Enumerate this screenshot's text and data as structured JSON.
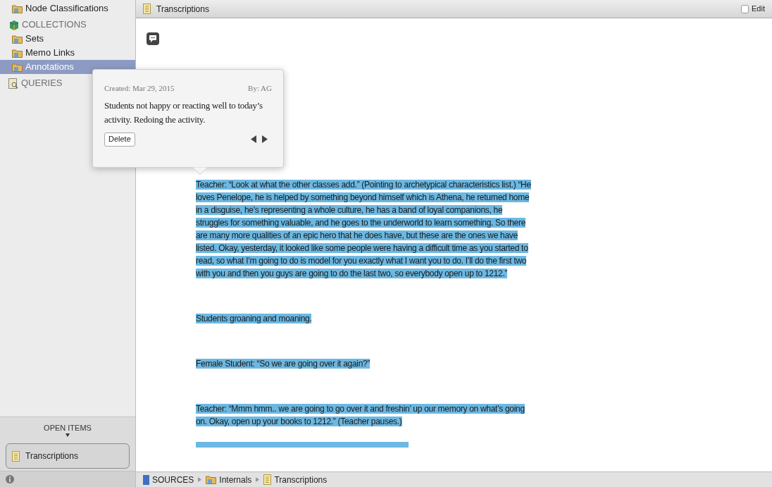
{
  "sidebar": {
    "items": [
      {
        "kind": "item",
        "label": "Node Classifications",
        "selected": false
      },
      {
        "kind": "section",
        "label": "COLLECTIONS",
        "children": [
          {
            "kind": "item",
            "label": "Sets",
            "selected": false
          },
          {
            "kind": "item",
            "label": "Memo Links",
            "selected": false
          },
          {
            "kind": "item",
            "label": "Annotations",
            "selected": true
          }
        ]
      },
      {
        "kind": "section",
        "label": "QUERIES"
      }
    ]
  },
  "open_items": {
    "label": "OPEN ITEMS",
    "items": [
      {
        "label": "Transcriptions",
        "selected": true
      }
    ]
  },
  "document": {
    "title": "Transcriptions",
    "edit": {
      "label": "Edit",
      "checked": false
    },
    "paragraphs": [
      {
        "text": "Teacher: “Look at what the other classes add.” (Pointing to archetypical characteristics list.) “He loves Penelope, he is helped by something beyond himself which is Athena, he returned home in a disguise, he’s representing a whole culture, he has a band of loyal companions, he struggles for something valuable, and he goes to the underworld to learn something. So there are many more qualities of an epic hero that he does have, but these are the ones we have listed. Okay, yesterday, it looked like some people were having a difficult time as you started to read, so what I’m going to do is model for you exactly what I want you to do. I’ll do the first two with you and then you guys are going to do the last two, so everybody open up to 1212.”",
        "highlighted": true
      },
      {
        "text": "Students groaning and moaning.",
        "highlighted": true
      },
      {
        "text": "Female Student: “So we are going over it again?”",
        "highlighted": true
      },
      {
        "text": "Teacher: “Mmm hmm.. we are going to go over it and freshin’ up our memory on what’s going on. Okay, open up your books to 1212.” (Teacher pauses.)",
        "highlighted": true
      }
    ]
  },
  "annotation": {
    "created": "Created: Mar 29, 2015",
    "author": "By: AG",
    "text": "Students not happy or reacting well to today’s activity. Redoing the activity.",
    "delete_button": "Delete"
  },
  "breadcrumb": [
    {
      "kind": "sources",
      "label": "SOURCES"
    },
    {
      "kind": "folder",
      "label": "Internals"
    },
    {
      "kind": "document",
      "label": "Transcriptions"
    }
  ]
}
